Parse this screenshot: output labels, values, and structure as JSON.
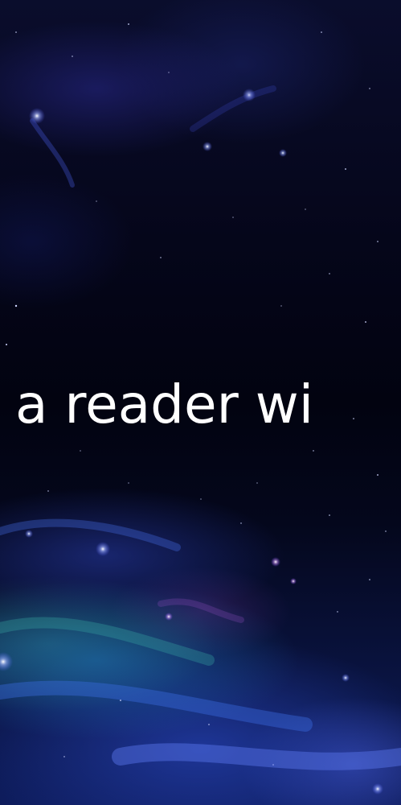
{
  "headline": {
    "text": "a reader wi"
  },
  "background": {
    "description_colors": {
      "deep_space": "#03040e",
      "nebula_blue": "#2a46c0",
      "nebula_teal": "#3caa96",
      "text": "#ffffff"
    }
  }
}
